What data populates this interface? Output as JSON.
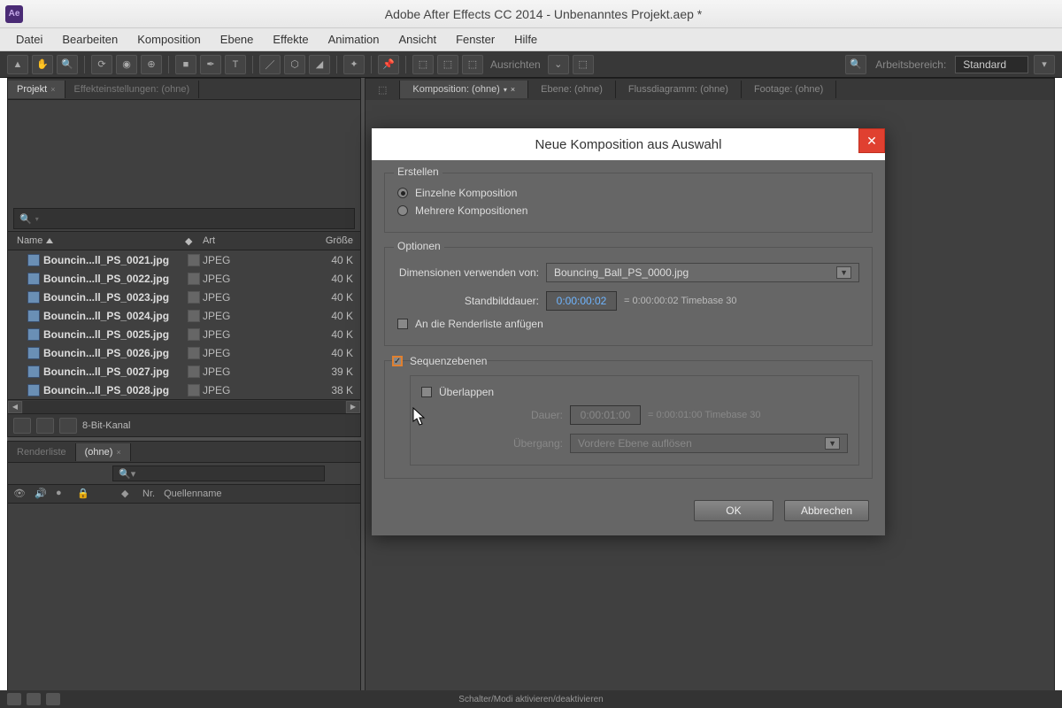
{
  "title": "Adobe After Effects CC 2014 - Unbenanntes Projekt.aep *",
  "ae_badge": "Ae",
  "menu": [
    "Datei",
    "Bearbeiten",
    "Komposition",
    "Ebene",
    "Effekte",
    "Animation",
    "Ansicht",
    "Fenster",
    "Hilfe"
  ],
  "toolbar": {
    "align_label": "Ausrichten",
    "workspace_label": "Arbeitsbereich:",
    "workspace_value": "Standard"
  },
  "project": {
    "tab_project": "Projekt",
    "tab_effects": "Effekteinstellungen: (ohne)",
    "columns": {
      "name": "Name",
      "type": "Art",
      "size": "Größe"
    },
    "rows": [
      {
        "name": "Bouncin...ll_PS_0021.jpg",
        "type": "JPEG",
        "size": "40 K"
      },
      {
        "name": "Bouncin...ll_PS_0022.jpg",
        "type": "JPEG",
        "size": "40 K"
      },
      {
        "name": "Bouncin...ll_PS_0023.jpg",
        "type": "JPEG",
        "size": "40 K"
      },
      {
        "name": "Bouncin...ll_PS_0024.jpg",
        "type": "JPEG",
        "size": "40 K"
      },
      {
        "name": "Bouncin...ll_PS_0025.jpg",
        "type": "JPEG",
        "size": "40 K"
      },
      {
        "name": "Bouncin...ll_PS_0026.jpg",
        "type": "JPEG",
        "size": "40 K"
      },
      {
        "name": "Bouncin...ll_PS_0027.jpg",
        "type": "JPEG",
        "size": "39 K"
      },
      {
        "name": "Bouncin...ll_PS_0028.jpg",
        "type": "JPEG",
        "size": "38 K"
      }
    ],
    "footer_label": "8-Bit-Kanal"
  },
  "timeline": {
    "tab_render": "Renderliste",
    "tab_none": "(ohne)",
    "col_nr": "Nr.",
    "col_source": "Quellenname"
  },
  "viewer": {
    "tabs": [
      "Komposition: (ohne)",
      "Ebene: (ohne)",
      "Flussdiagramm: (ohne)",
      "Footage: (ohne)"
    ]
  },
  "dialog": {
    "title": "Neue Komposition aus Auswahl",
    "grp_create": "Erstellen",
    "radio_single": "Einzelne Komposition",
    "radio_multiple": "Mehrere Kompositionen",
    "grp_options": "Optionen",
    "dim_label": "Dimensionen verwenden von:",
    "dim_value": "Bouncing_Ball_PS_0000.jpg",
    "still_label": "Standbilddauer:",
    "still_value": "0:00:00:02",
    "still_info": "= 0:00:00:02  Timebase 30",
    "append_render": "An die Renderliste anfügen",
    "grp_seq": "Sequenzebenen",
    "overlap": "Überlappen",
    "duration_label": "Dauer:",
    "duration_value": "0:00:01:00",
    "duration_info": "= 0:00:01:00  Timebase 30",
    "transition_label": "Übergang:",
    "transition_value": "Vordere Ebene auflösen",
    "btn_ok": "OK",
    "btn_cancel": "Abbrechen"
  },
  "status": "Schalter/Modi aktivieren/deaktivieren"
}
